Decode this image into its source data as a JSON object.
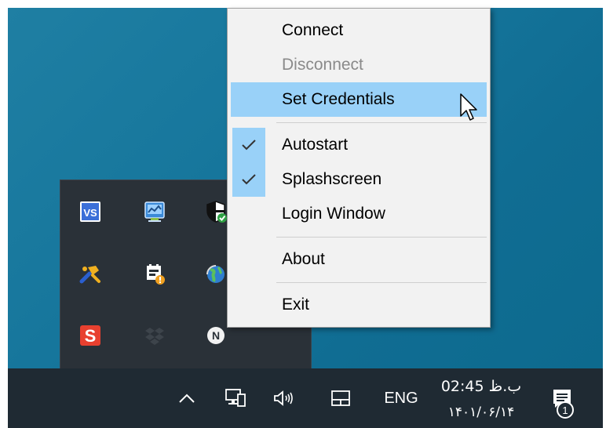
{
  "context_menu": {
    "items": [
      {
        "label": "Connect",
        "enabled": true,
        "checked": false,
        "highlighted": false
      },
      {
        "label": "Disconnect",
        "enabled": false,
        "checked": false,
        "highlighted": false
      },
      {
        "label": "Set Credentials",
        "enabled": true,
        "checked": false,
        "highlighted": true
      },
      {
        "label": "Autostart",
        "enabled": true,
        "checked": true,
        "highlighted": false
      },
      {
        "label": "Splashscreen",
        "enabled": true,
        "checked": true,
        "highlighted": false
      },
      {
        "label": "Login Window",
        "enabled": true,
        "checked": false,
        "highlighted": false
      },
      {
        "label": "About",
        "enabled": true,
        "checked": false,
        "highlighted": false
      },
      {
        "label": "Exit",
        "enabled": true,
        "checked": false,
        "highlighted": false
      }
    ],
    "check_glyph": "✓",
    "colors": {
      "background": "#f2f2f2",
      "highlight": "#99d1f8",
      "disabled_text": "#8a8a8a"
    }
  },
  "tray_flyout": {
    "icons": [
      {
        "name": "vs-app-icon",
        "text": "VS"
      },
      {
        "name": "network-monitor-icon"
      },
      {
        "name": "shield-security-icon"
      },
      {
        "name": "hammer-tool-icon"
      },
      {
        "name": "app-warning-icon"
      },
      {
        "name": "globe-sync-icon"
      },
      {
        "name": "s-app-icon",
        "text": "S"
      },
      {
        "name": "dropbox-icon"
      },
      {
        "name": "n-circle-icon",
        "text": "N"
      }
    ]
  },
  "taskbar": {
    "background": "#1f2a33",
    "language": "ENG",
    "clock": {
      "time": "02:45 ب.ظ",
      "date": "۱۴۰۱/۰۶/۱۴"
    },
    "notification_count": "1"
  },
  "desktop": {
    "background": "#16769c"
  }
}
